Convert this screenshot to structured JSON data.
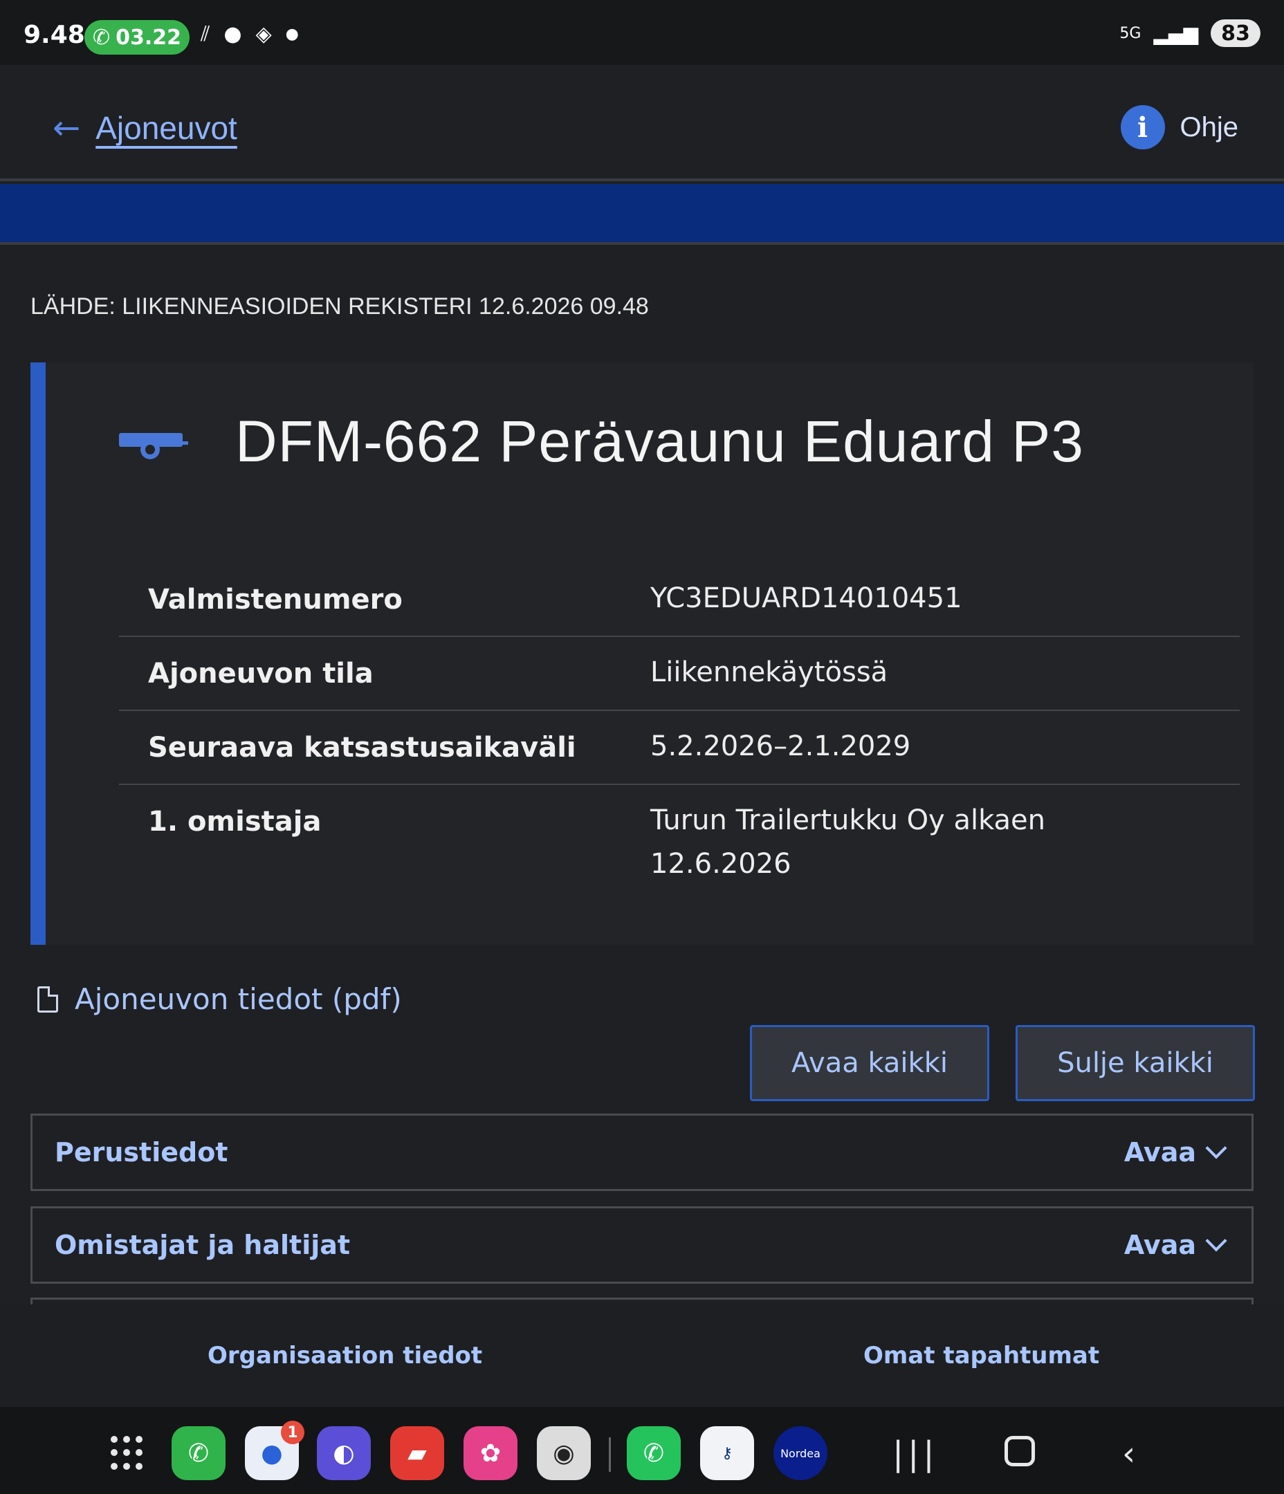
{
  "status_bar": {
    "time": "9.48",
    "call_timer": "03.22",
    "battery": "83",
    "network": "5G"
  },
  "header": {
    "back_label": "Ajoneuvot",
    "help_label": "Ohje"
  },
  "source_line": "LÄHDE: LIIKENNEASIOIDEN REKISTERI 12.6.2026 09.48",
  "vehicle": {
    "title": "DFM-662 Perävaunu Eduard P3",
    "details": [
      {
        "key": "Valmistenumero",
        "value": "YC3EDUARD14010451"
      },
      {
        "key": "Ajoneuvon tila",
        "value": "Liikennekäytössä"
      },
      {
        "key": "Seuraava katsastusaikaväli",
        "value": "5.2.2026–2.1.2029"
      },
      {
        "key": "1. omistaja",
        "value": "Turun Trailertukku Oy alkaen 12.6.2026"
      }
    ]
  },
  "pdf_link": "Ajoneuvon tiedot (pdf)",
  "buttons": {
    "open_all": "Avaa kaikki",
    "close_all": "Sulje kaikki"
  },
  "accordions": [
    {
      "title": "Perustiedot",
      "action": "Avaa"
    },
    {
      "title": "Omistajat ja haltijat",
      "action": "Avaa"
    }
  ],
  "bottom_nav": {
    "left": "Organisaation tiedot",
    "right": "Omat tapahtumat"
  },
  "taskbar": {
    "messages_badge": "1",
    "nordea_label": "Nordea",
    "apps": [
      "app-drawer-icon",
      "phone-icon",
      "messages-icon",
      "browser-icon",
      "notes-icon",
      "gallery-icon",
      "camera-icon",
      "whatsapp-icon",
      "nordea-codes-icon",
      "nordea-icon"
    ]
  },
  "colors": {
    "accent_blue": "#2a5cc4",
    "link_blue": "#a9c6ff",
    "band_blue": "#0a2c7d",
    "call_green": "#37b24d"
  }
}
